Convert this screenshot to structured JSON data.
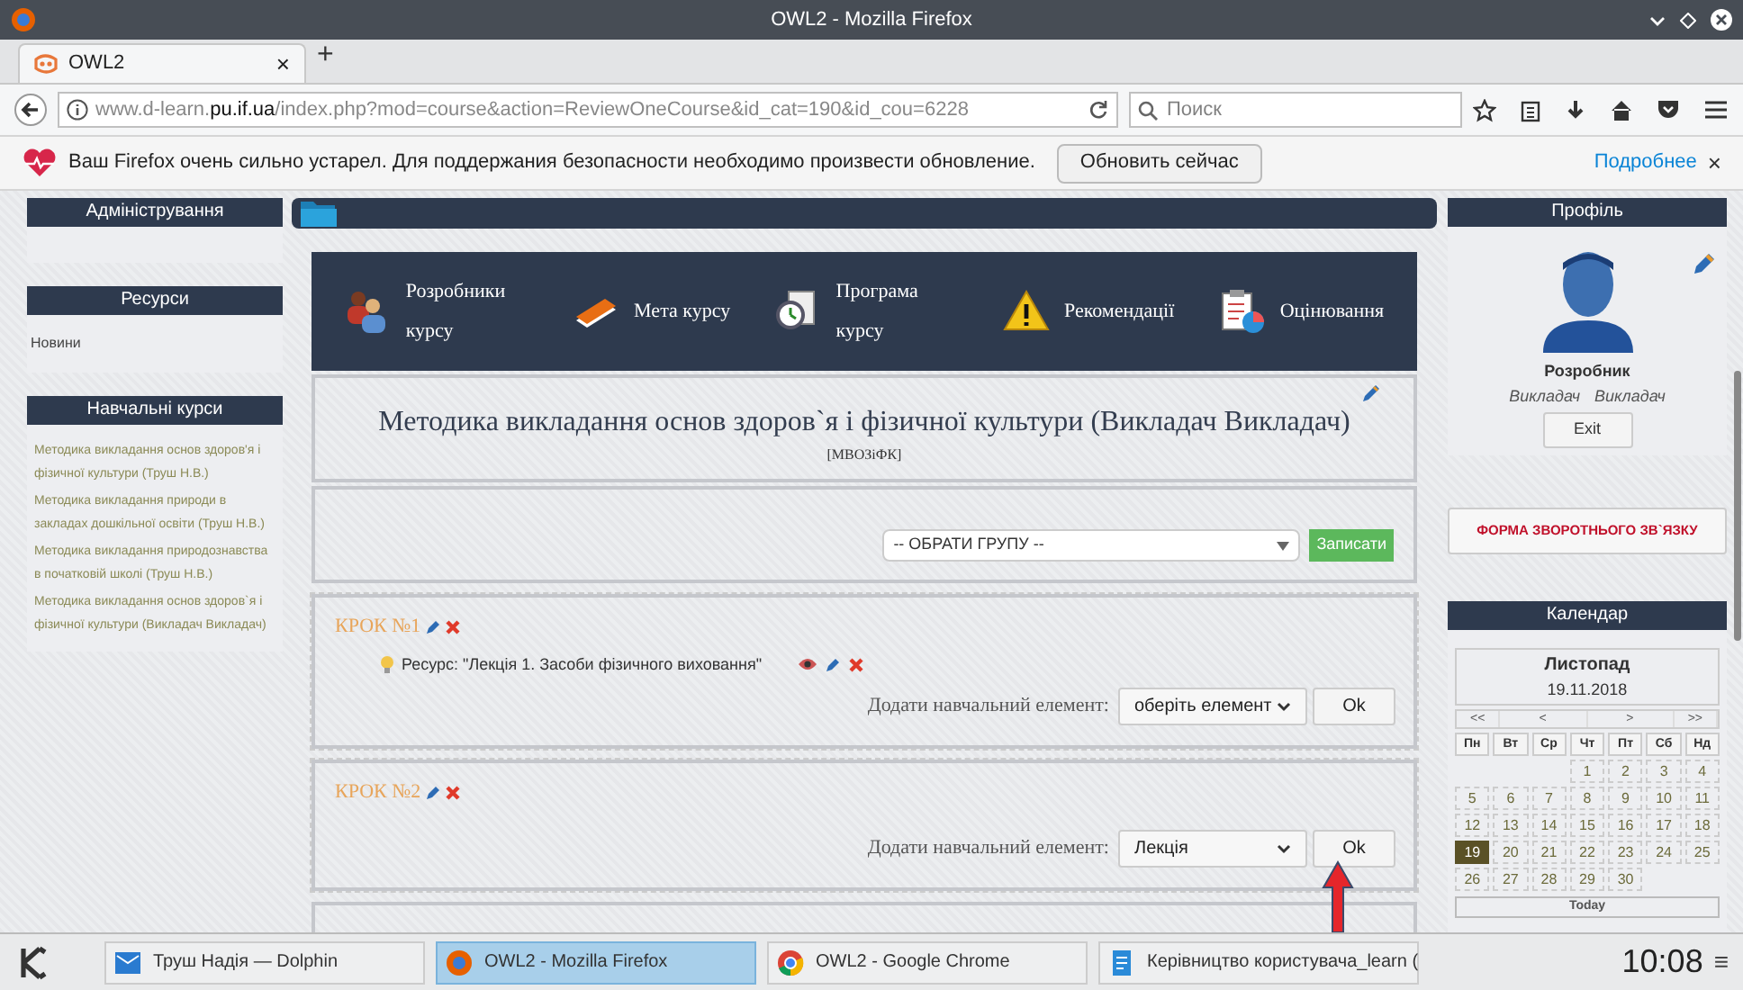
{
  "window": {
    "title": "OWL2 - Mozilla Firefox"
  },
  "tabs": [
    {
      "label": "OWL2",
      "selected": true,
      "close": "×"
    }
  ],
  "new_tab": "+",
  "address": {
    "host_pre": "www.d-learn.",
    "host_main": "pu.if.ua",
    "path": "/index.php?mod=course&action=ReviewOneCourse&id_cat=190&id_cou=6228"
  },
  "search": {
    "placeholder": "Поиск"
  },
  "notification": {
    "message": "Ваш Firefox очень сильно устарел. Для поддержания безопасности необходимо произвести обновление.",
    "button": "Обновить сейчас",
    "link": "Подробнее",
    "close": "×"
  },
  "left_sidebar": [
    {
      "title": "Адміністрування"
    },
    {
      "title": "Ресурси",
      "items": [
        "Новини"
      ],
      "kind": "plain"
    },
    {
      "title": "Навчальні курси",
      "items": [
        "Методика викладання основ здоров'я і фізичної культури (Труш Н.В.)",
        "Методика викладання природи в закладах дошкільної освіти (Труш Н.В.)",
        "Методика викладання природознавства в початковій школі (Труш Н.В.)",
        "Методика викладання основ здоров`я і фізичної культури (Викладач Викладач)"
      ],
      "kind": "courses"
    }
  ],
  "course_menu": [
    {
      "label": "Розробники курсу",
      "kind": "people"
    },
    {
      "label": "Мета курсу",
      "kind": "book"
    },
    {
      "label": "Програма курсу",
      "kind": "clock"
    },
    {
      "label": "Рекомендації",
      "kind": "warning"
    },
    {
      "label": "Оцінювання",
      "kind": "clipboard"
    }
  ],
  "course": {
    "title": "Методика викладання основ здоров`я і фізичної культури (Викладач Викладач)",
    "code": "[МВОЗіФК]"
  },
  "group": {
    "select": "-- ОБРАТИ ГРУПУ --",
    "button": "Записати"
  },
  "steps": [
    {
      "title": "КРОК №1",
      "resources": [
        "Ресурс: \"Лекція 1. Засоби фізичного виховання\""
      ],
      "add_label": "Додати навчальний елемент:",
      "select": "оберіть елемент",
      "button": "Ok"
    },
    {
      "title": "КРОК №2",
      "add_label": "Додати навчальний елемент:",
      "select": "Лекція",
      "button": "Ok"
    }
  ],
  "profile": {
    "title": "Профіль",
    "role": "Розробник",
    "first": "Викладач",
    "last": "Викладач",
    "exit": "Exit"
  },
  "feedback": "ФОРМА ЗВОРОТНЬОГО ЗВ`ЯЗКУ",
  "calendar": {
    "title": "Календар",
    "month": "Листопад",
    "date": "19.11.2018",
    "nav": [
      "<<",
      "<",
      ">",
      ">>"
    ],
    "weekdays": [
      "Пн",
      "Вт",
      "Ср",
      "Чт",
      "Пт",
      "Сб",
      "Нд"
    ],
    "weeks": [
      [
        {
          "day": "1",
          "selected": false
        },
        {
          "day": "2",
          "selected": false
        },
        {
          "day": "3",
          "selected": false
        },
        {
          "day": "4",
          "selected": false
        }
      ],
      [
        {
          "day": "5",
          "selected": false
        },
        {
          "day": "6",
          "selected": false
        },
        {
          "day": "7",
          "selected": false
        },
        {
          "day": "8",
          "selected": false
        },
        {
          "day": "9",
          "selected": false
        },
        {
          "day": "10",
          "selected": false
        },
        {
          "day": "11",
          "selected": false
        }
      ],
      [
        {
          "day": "12",
          "selected": false
        },
        {
          "day": "13",
          "selected": false
        },
        {
          "day": "14",
          "selected": false
        },
        {
          "day": "15",
          "selected": false
        },
        {
          "day": "16",
          "selected": false
        },
        {
          "day": "17",
          "selected": false
        },
        {
          "day": "18",
          "selected": false
        }
      ],
      [
        {
          "day": "19",
          "selected": true
        },
        {
          "day": "20",
          "selected": false
        },
        {
          "day": "21",
          "selected": false
        },
        {
          "day": "22",
          "selected": false
        },
        {
          "day": "23",
          "selected": false
        },
        {
          "day": "24",
          "selected": false
        },
        {
          "day": "25",
          "selected": false
        }
      ],
      [
        {
          "day": "26",
          "selected": false
        },
        {
          "day": "27",
          "selected": false
        },
        {
          "day": "28",
          "selected": false
        },
        {
          "day": "29",
          "selected": false
        },
        {
          "day": "30",
          "selected": false
        }
      ]
    ],
    "today": "Today"
  },
  "taskbar": {
    "items": [
      {
        "label": "Труш Надія — Dolphin",
        "kind": "folder",
        "selected": false
      },
      {
        "label": "OWL2 - Mozilla Firefox",
        "kind": "firefox",
        "selected": true
      },
      {
        "label": "OWL2 - Google Chrome",
        "kind": "chrome",
        "selected": false
      },
      {
        "label": "Керівництво користувача_learn (",
        "kind": "doc",
        "selected": false
      }
    ],
    "clock": "10:08",
    "menu": "≡"
  }
}
